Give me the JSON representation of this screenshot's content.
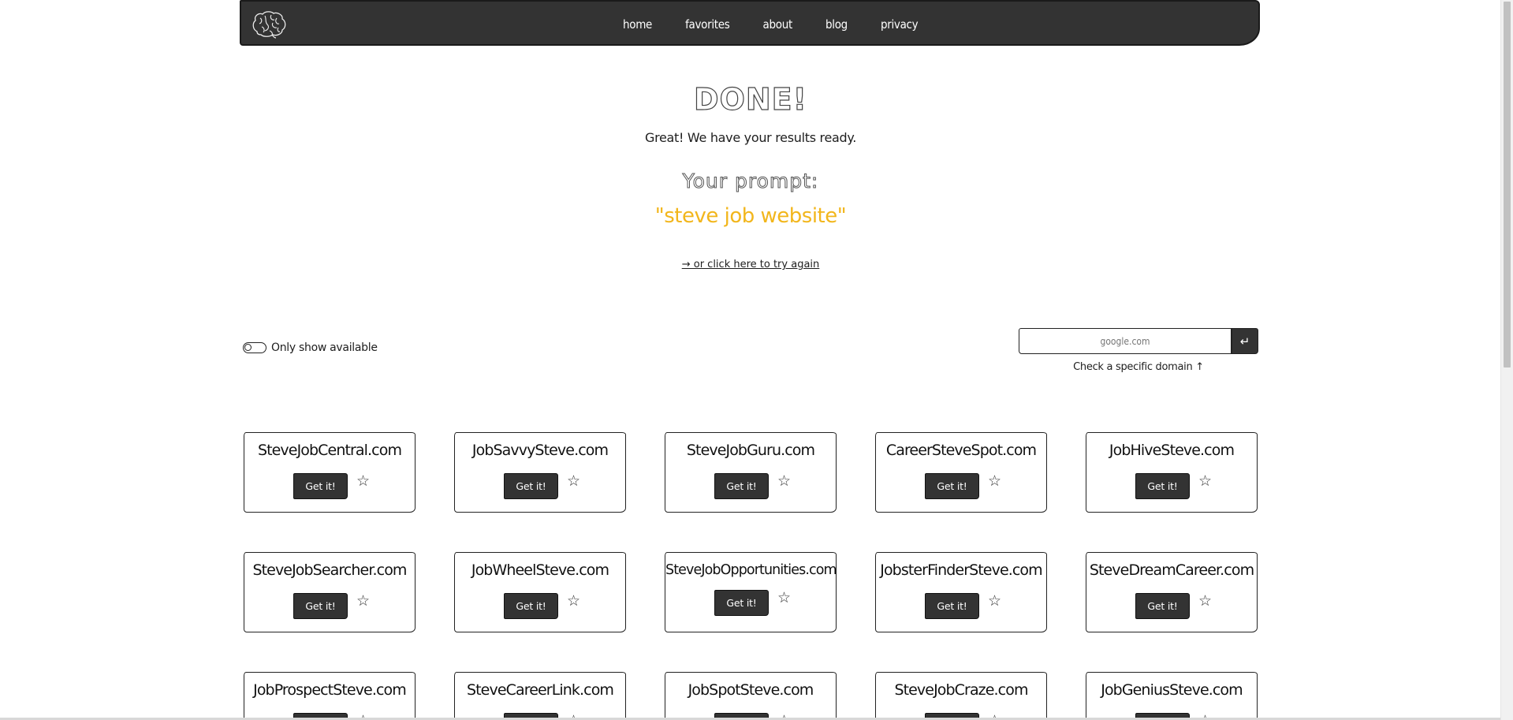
{
  "nav": {
    "items": [
      "home",
      "favorites",
      "about",
      "blog",
      "privacy"
    ]
  },
  "result": {
    "title": "DONE!",
    "subtitle": "Great! We have your results ready.",
    "prompt_heading": "Your prompt:",
    "prompt_text": "\"steve job website\"",
    "try_again": "→ or click here to try again"
  },
  "filters": {
    "only_available_label": "Only show available",
    "only_available_on": false
  },
  "domain_check": {
    "placeholder": "google.com",
    "submit_icon": "enter-arrow-icon",
    "submit_glyph": "↵",
    "hint": "Check a specific domain ↑"
  },
  "cards": {
    "button_label": "Get it!",
    "star_glyph": "☆",
    "domains": [
      "SteveJobCentral.com",
      "JobSavvySteve.com",
      "SteveJobGuru.com",
      "CareerSteveSpot.com",
      "JobHiveSteve.com",
      "SteveJobSearcher.com",
      "JobWheelSteve.com",
      "SteveJobOpportunities.com",
      "JobsterFinderSteve.com",
      "SteveDreamCareer.com",
      "JobProspectSteve.com",
      "SteveCareerLink.com",
      "JobSpotSteve.com",
      "SteveJobCraze.com",
      "JobGeniusSteve.com"
    ]
  },
  "colors": {
    "navbar": "#333333",
    "prompt_accent": "#f2b61c",
    "button": "#333333"
  }
}
